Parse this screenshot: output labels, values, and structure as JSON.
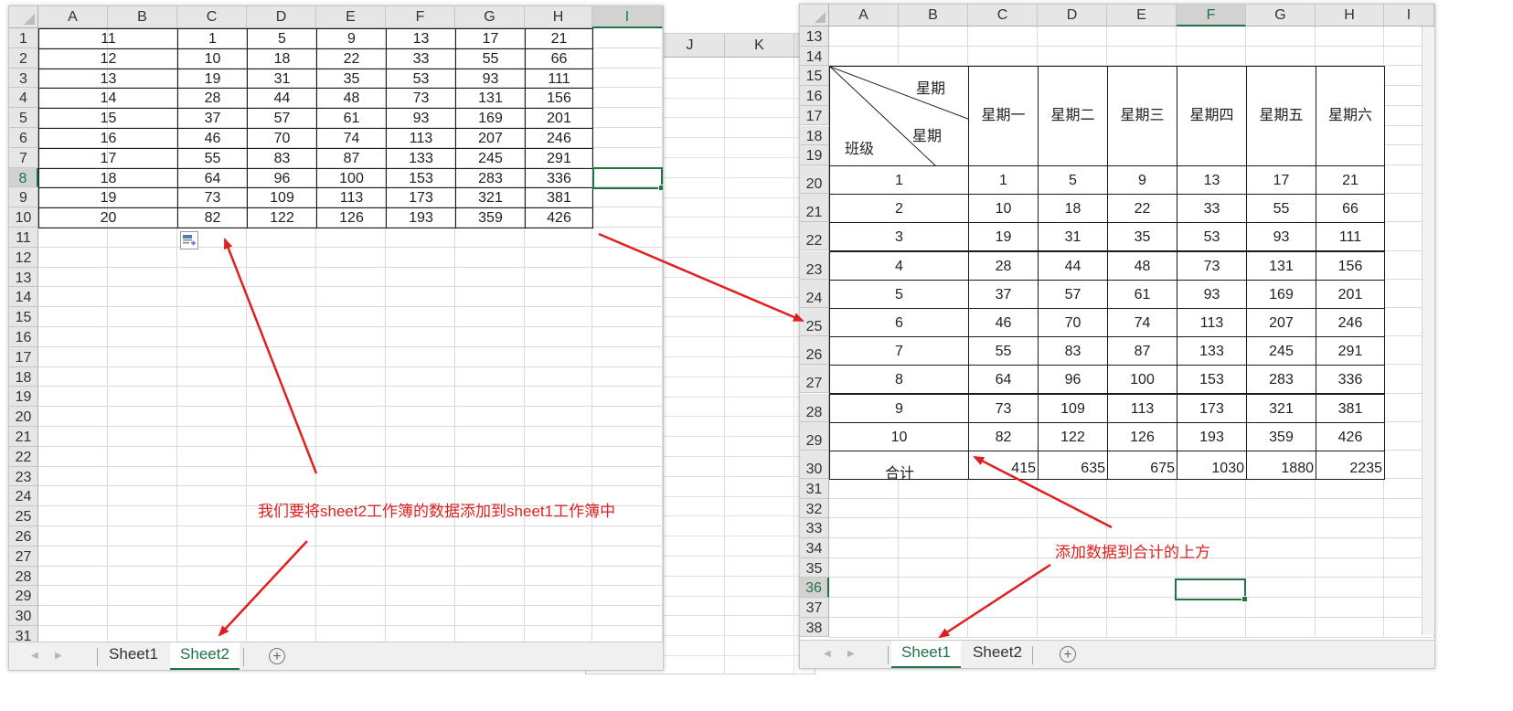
{
  "left": {
    "columns": [
      "A",
      "B",
      "C",
      "D",
      "E",
      "F",
      "G",
      "H",
      "I"
    ],
    "rows": [
      "1",
      "2",
      "3",
      "4",
      "5",
      "6",
      "7",
      "8",
      "9",
      "10",
      "11",
      "12",
      "13",
      "14",
      "15",
      "16",
      "17",
      "18",
      "19",
      "20",
      "21",
      "22",
      "23",
      "24",
      "25",
      "26",
      "27",
      "28",
      "29",
      "30",
      "31"
    ],
    "selected_row": "8",
    "selected_col": "I",
    "data": [
      [
        "11",
        "1",
        "5",
        "9",
        "13",
        "17",
        "21"
      ],
      [
        "12",
        "10",
        "18",
        "22",
        "33",
        "55",
        "66"
      ],
      [
        "13",
        "19",
        "31",
        "35",
        "53",
        "93",
        "111"
      ],
      [
        "14",
        "28",
        "44",
        "48",
        "73",
        "131",
        "156"
      ],
      [
        "15",
        "37",
        "57",
        "61",
        "93",
        "169",
        "201"
      ],
      [
        "16",
        "46",
        "70",
        "74",
        "113",
        "207",
        "246"
      ],
      [
        "17",
        "55",
        "83",
        "87",
        "133",
        "245",
        "291"
      ],
      [
        "18",
        "64",
        "96",
        "100",
        "153",
        "283",
        "336"
      ],
      [
        "19",
        "73",
        "109",
        "113",
        "173",
        "321",
        "381"
      ],
      [
        "20",
        "82",
        "122",
        "126",
        "193",
        "359",
        "426"
      ]
    ],
    "tabs": [
      "Sheet1",
      "Sheet2"
    ],
    "active_tab": "Sheet2"
  },
  "background_window": {
    "columns": [
      "J",
      "K"
    ]
  },
  "right": {
    "columns": [
      "A",
      "B",
      "C",
      "D",
      "E",
      "F",
      "G",
      "H",
      "I"
    ],
    "rows": [
      "13",
      "14",
      "15",
      "16",
      "17",
      "18",
      "19",
      "20",
      "21",
      "22",
      "23",
      "24",
      "25",
      "26",
      "27",
      "28",
      "29",
      "30",
      "31",
      "32",
      "33",
      "34",
      "35",
      "36",
      "37",
      "38"
    ],
    "selected_row": "36",
    "selected_col": "F",
    "header": {
      "diag_top": "星期",
      "diag_mid": "星期",
      "diag_bottom": "班级",
      "days": [
        "星期一",
        "星期二",
        "星期三",
        "星期四",
        "星期五",
        "星期六"
      ]
    },
    "data": [
      [
        "1",
        "1",
        "5",
        "9",
        "13",
        "17",
        "21"
      ],
      [
        "2",
        "10",
        "18",
        "22",
        "33",
        "55",
        "66"
      ],
      [
        "3",
        "19",
        "31",
        "35",
        "53",
        "93",
        "111"
      ],
      [
        "4",
        "28",
        "44",
        "48",
        "73",
        "131",
        "156"
      ],
      [
        "5",
        "37",
        "57",
        "61",
        "93",
        "169",
        "201"
      ],
      [
        "6",
        "46",
        "70",
        "74",
        "113",
        "207",
        "246"
      ],
      [
        "7",
        "55",
        "83",
        "87",
        "133",
        "245",
        "291"
      ],
      [
        "8",
        "64",
        "96",
        "100",
        "153",
        "283",
        "336"
      ],
      [
        "9",
        "73",
        "109",
        "113",
        "173",
        "321",
        "381"
      ],
      [
        "10",
        "82",
        "122",
        "126",
        "193",
        "359",
        "426"
      ]
    ],
    "total": [
      "合计",
      "415",
      "635",
      "675",
      "1030",
      "1880",
      "2235"
    ],
    "tabs": [
      "Sheet1",
      "Sheet2"
    ],
    "active_tab": "Sheet1"
  },
  "annotations": {
    "left_note": "我们要将sheet2工作簿的数据添加到sheet1工作簿中",
    "right_note": "添加数据到合计的上方"
  },
  "colors": {
    "accent": "#217346",
    "annotation": "#e02020"
  },
  "icons": {
    "paste_options": "paste-options-icon",
    "add_sheet": "plus-circle-icon"
  }
}
